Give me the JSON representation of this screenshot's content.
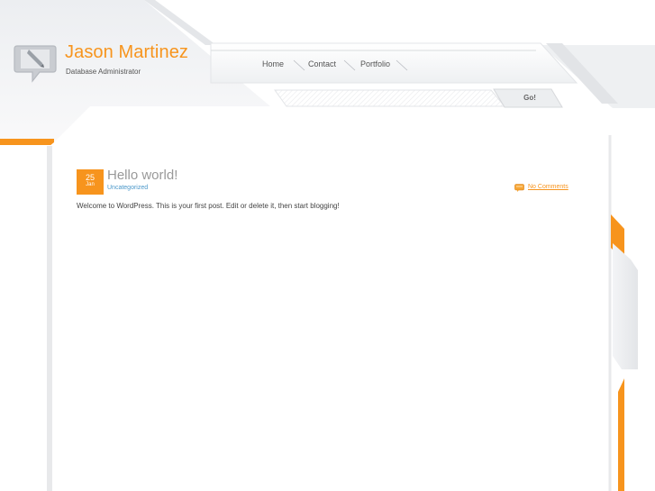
{
  "header": {
    "title": "Jason Martinez",
    "subtitle": "Database Administrator",
    "logo_icon": "speech-bubble-pencil-icon"
  },
  "nav": {
    "items": [
      {
        "label": "Home"
      },
      {
        "label": "Contact"
      },
      {
        "label": "Portfolio"
      }
    ]
  },
  "search": {
    "placeholder": "",
    "value": "",
    "button_label": "Go!"
  },
  "post": {
    "date_day": "25",
    "date_month": "Jan",
    "title": "Hello world!",
    "category": "Uncategorized",
    "comments": "No Comments",
    "comments_icon": "comment-bubble-icon",
    "body": "Welcome to WordPress. This is your first post. Edit or delete it, then start blogging!"
  },
  "colors": {
    "accent": "#f7941d",
    "link_blue": "#4a97c9",
    "panel": "#ffffff",
    "chrome": "#e8e9eb"
  }
}
